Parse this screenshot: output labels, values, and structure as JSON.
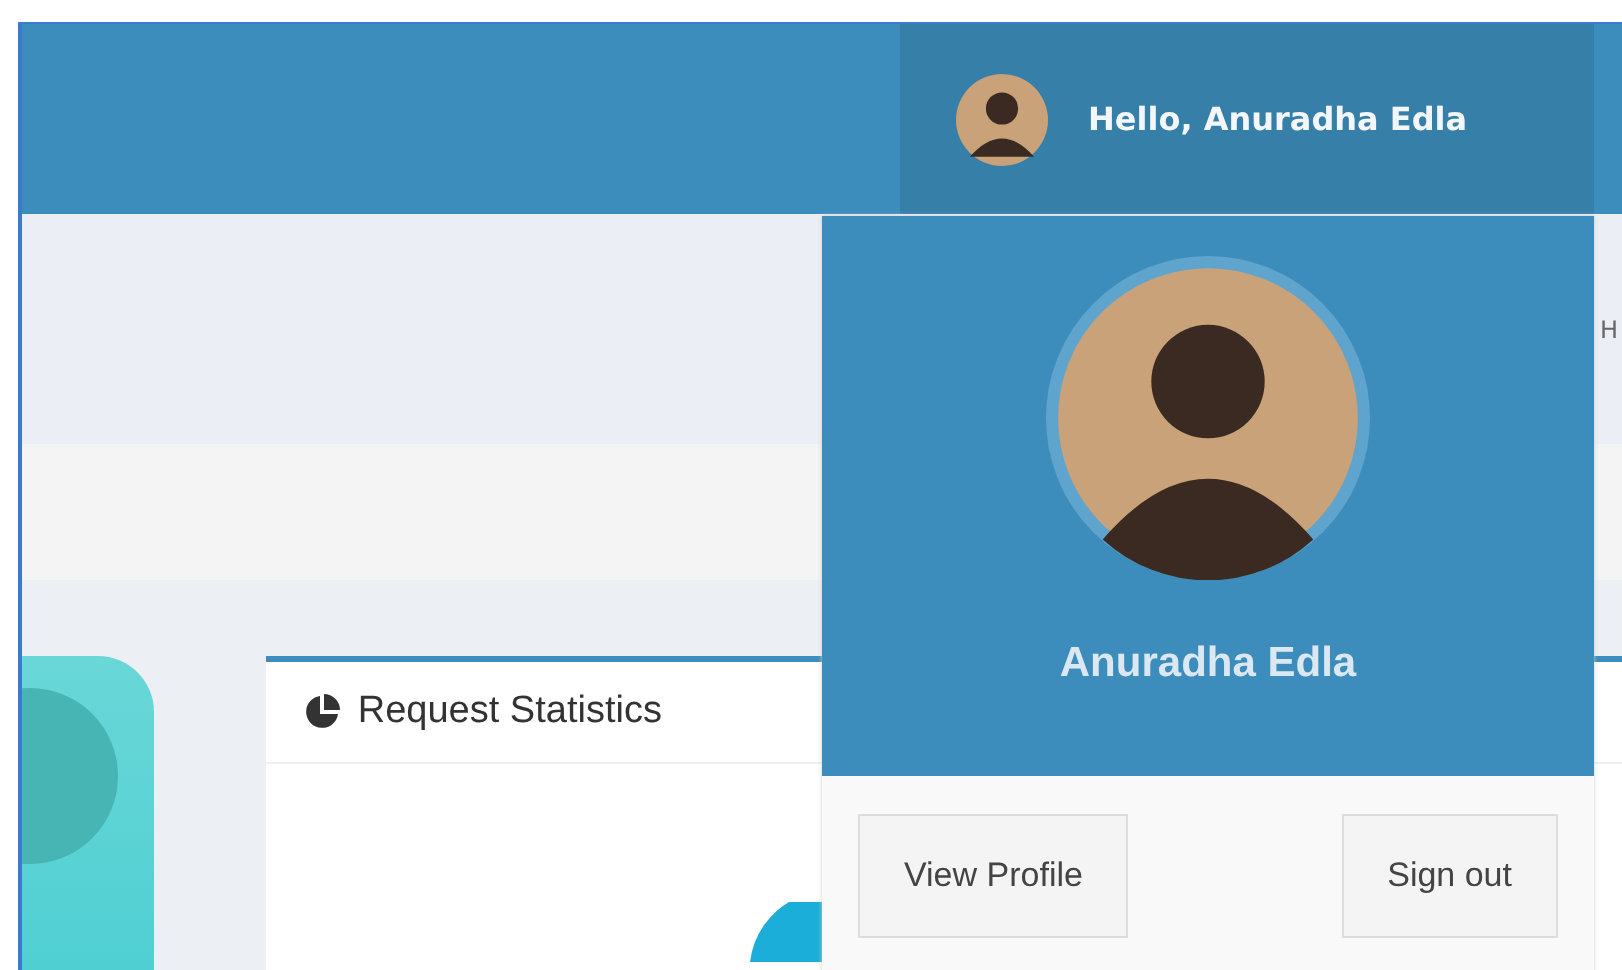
{
  "header": {
    "user_greeting": "Hello, Anuradha Edla"
  },
  "content": {
    "side_label": "H",
    "card": {
      "title": "Request Statistics"
    }
  },
  "user_dropdown": {
    "name": "Anuradha Edla",
    "buttons": [
      "View Profile",
      "Sign out"
    ]
  }
}
